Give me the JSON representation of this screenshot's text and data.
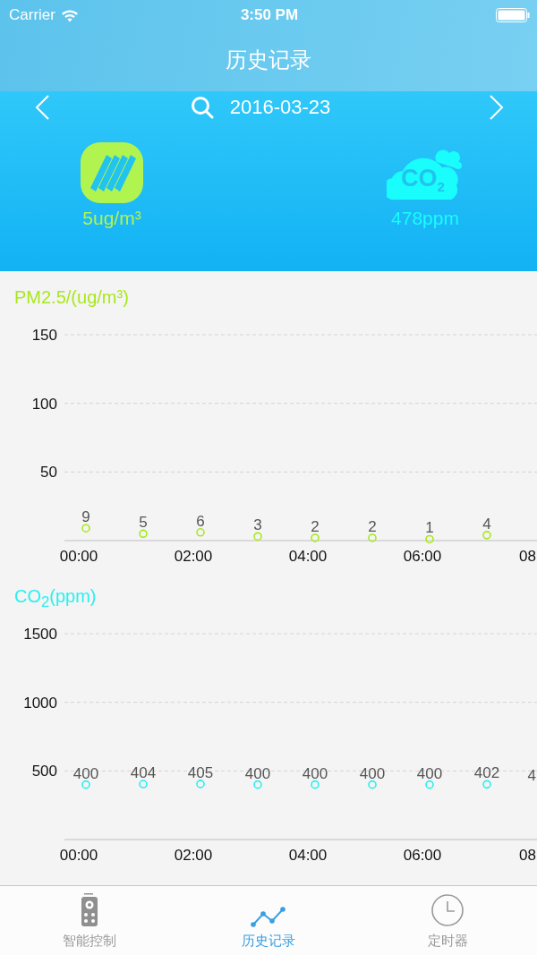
{
  "status_bar": {
    "carrier": "Carrier",
    "time": "3:50 PM"
  },
  "nav": {
    "title": "历史记录"
  },
  "date_bar": {
    "date": "2016-03-23"
  },
  "readings": [
    {
      "kind": "pm",
      "value": "5ug/m³",
      "color": "#b2f44f"
    },
    {
      "kind": "co2",
      "icon_text": "CO$_{2}$",
      "value": "478ppm",
      "color": "#19fdfd"
    }
  ],
  "charts": [
    {
      "chart_data": {
        "type": "scatter",
        "title": "PM2.5/(ug/m³)",
        "x": [
          0.125,
          1.125,
          2.125,
          3.125,
          4.125,
          5.125,
          6.125,
          7.125
        ],
        "series": [
          {
            "color": "#a8e81c",
            "values": [
              9,
              5,
              6,
              3,
              2,
              2,
              1,
              4
            ]
          }
        ],
        "xlim": [
          -0.25,
          8
        ],
        "ylim": [
          0,
          150
        ],
        "yticks": [
          50,
          100,
          150
        ],
        "xticks": [
          {
            "value": 0,
            "label": "00:00"
          },
          {
            "value": 2,
            "label": "02:00"
          },
          {
            "value": 4,
            "label": "04:00"
          },
          {
            "value": 6,
            "label": "06:00"
          },
          {
            "value": 8,
            "label": "08"
          }
        ],
        "grid": true,
        "data_labels": true
      }
    },
    {
      "chart_data": {
        "type": "scatter",
        "title": "CO$_{2}$(ppm)",
        "x": [
          0.125,
          1.125,
          2.125,
          3.125,
          4.125,
          5.125,
          6.125,
          7.125
        ],
        "series": [
          {
            "color": "#29f0f0",
            "values": [
              400,
              404,
              405,
              400,
              400,
              400,
              400,
              402
            ]
          }
        ],
        "xlim": [
          -0.25,
          8
        ],
        "ylim": [
          0,
          1500
        ],
        "yticks": [
          500,
          1000,
          1500
        ],
        "xticks": [
          {
            "value": 0,
            "label": "00:00"
          },
          {
            "value": 2,
            "label": "02:00"
          },
          {
            "value": 4,
            "label": "04:00"
          },
          {
            "value": 6,
            "label": "06:00"
          },
          {
            "value": 8,
            "label": "08"
          }
        ],
        "grid": true,
        "data_labels": true,
        "annotations": [
          "4"
        ]
      }
    }
  ],
  "tabs": [
    {
      "kind": "remote",
      "label": "智能控制",
      "selected": false
    },
    {
      "kind": "chart",
      "label": "历史记录",
      "selected": true
    },
    {
      "kind": "clock",
      "label": "定时器",
      "selected": false
    }
  ]
}
